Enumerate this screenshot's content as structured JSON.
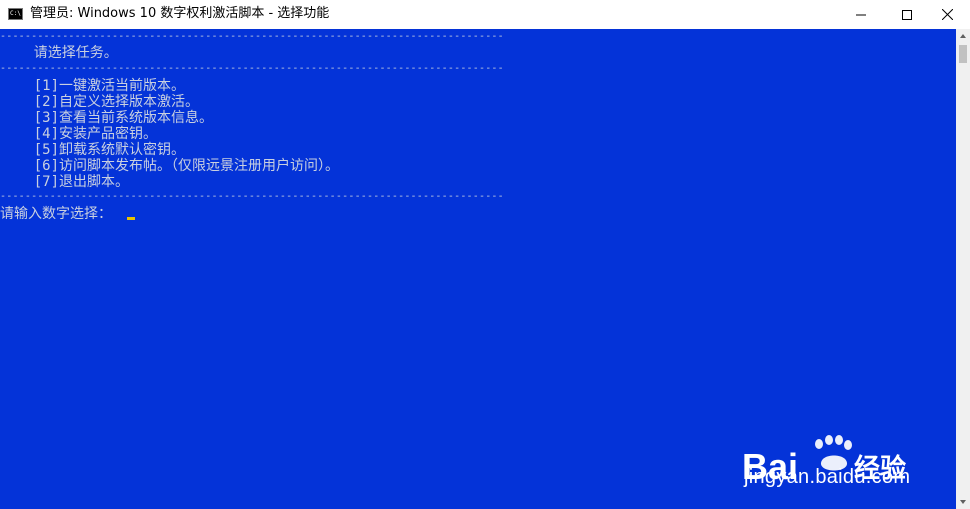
{
  "window": {
    "title": "管理员:  Windows 10 数字权利激活脚本 - 选择功能",
    "app_icon_glyph": "C:\\",
    "controls": {
      "minimize": "minimize-icon",
      "maximize": "maximize-icon",
      "close": "close-icon"
    }
  },
  "console": {
    "background": "#0433d8",
    "text_color": "#c9d0e0",
    "separator": "----------------------------------------------------------------------------------------------------",
    "header": "    请选择任务。",
    "menu_items": [
      "    [1]一键激活当前版本。",
      "    [2]自定义选择版本激活。",
      "    [3]查看当前系统版本信息。",
      "    [4]安装产品密钥。",
      "    [5]卸载系统默认密钥。",
      "    [6]访问脚本发布帖。（仅限远景注册用户访问）。",
      "    [7]退出脚本。"
    ],
    "prompt": "请输入数字选择：",
    "cursor_color": "#e8c200"
  },
  "watermark": {
    "logo_text": "Bai",
    "logo_text_2": "经验",
    "url": "jingyan.baidu.com"
  }
}
